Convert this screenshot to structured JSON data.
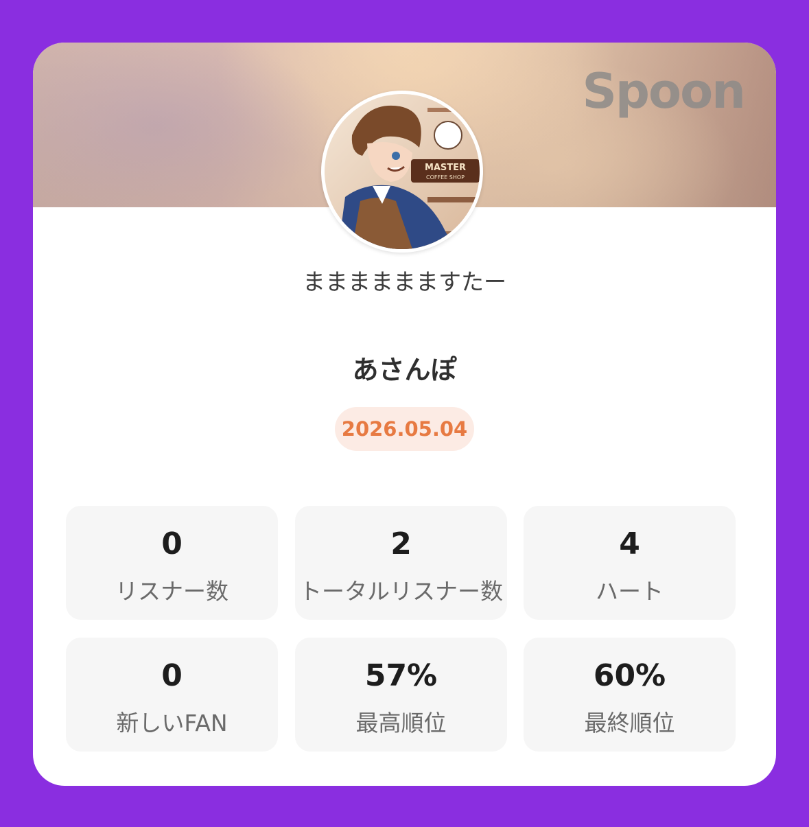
{
  "brand": {
    "logo_text": "Spoon"
  },
  "profile": {
    "dj_name": "まままままますたー",
    "broadcast_title": "あさんぽ",
    "date": "2026.05.04"
  },
  "stats": [
    {
      "value": "0",
      "label": "リスナー数"
    },
    {
      "value": "2",
      "label": "トータルリスナー数"
    },
    {
      "value": "4",
      "label": "ハート"
    },
    {
      "value": "0",
      "label": "新しいFAN"
    },
    {
      "value": "57%",
      "label": "最高順位"
    },
    {
      "value": "60%",
      "label": "最終順位"
    }
  ],
  "avatar_sign": {
    "line1": "MASTER",
    "line2": "COFFEE SHOP"
  },
  "colors": {
    "background": "#8a2ee0",
    "card": "#ffffff",
    "date_text": "#e77a42",
    "date_badge": "#fcebe4",
    "stat_box": "#f6f6f6"
  }
}
